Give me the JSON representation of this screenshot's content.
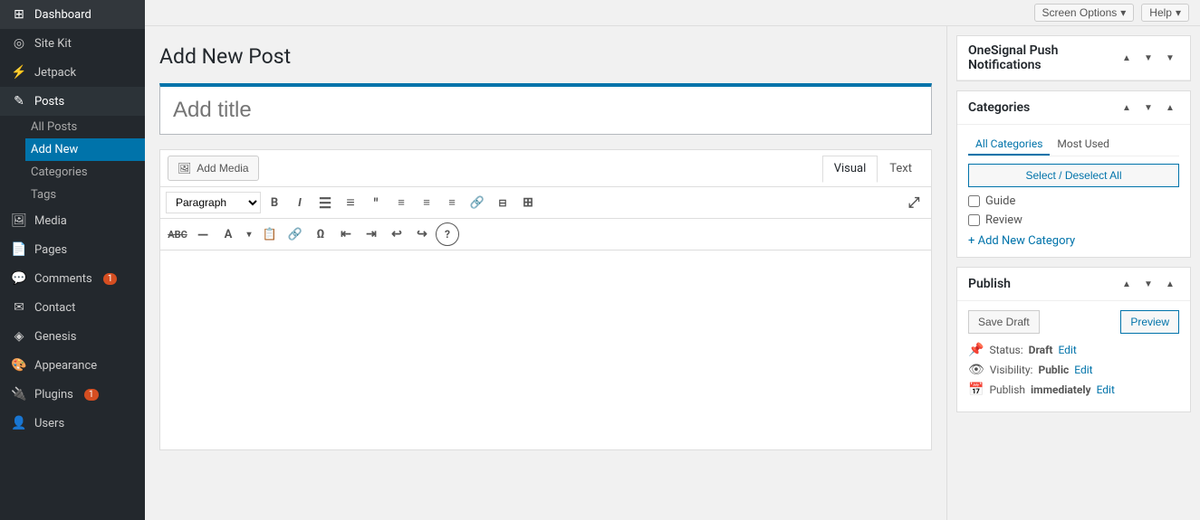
{
  "sidebar": {
    "items": [
      {
        "id": "dashboard",
        "label": "Dashboard",
        "icon": "⊞"
      },
      {
        "id": "site-kit",
        "label": "Site Kit",
        "icon": "◎"
      },
      {
        "id": "jetpack",
        "label": "Jetpack",
        "icon": "⚡"
      },
      {
        "id": "posts",
        "label": "Posts",
        "icon": "✎",
        "active": true,
        "children": [
          {
            "id": "all-posts",
            "label": "All Posts"
          },
          {
            "id": "add-new",
            "label": "Add New",
            "active": true
          },
          {
            "id": "categories",
            "label": "Categories"
          },
          {
            "id": "tags",
            "label": "Tags"
          }
        ]
      },
      {
        "id": "media",
        "label": "Media",
        "icon": "🖼"
      },
      {
        "id": "pages",
        "label": "Pages",
        "icon": "📄"
      },
      {
        "id": "comments",
        "label": "Comments",
        "icon": "💬",
        "badge": "1"
      },
      {
        "id": "contact",
        "label": "Contact",
        "icon": "✉"
      },
      {
        "id": "genesis",
        "label": "Genesis",
        "icon": "◈"
      },
      {
        "id": "appearance",
        "label": "Appearance",
        "icon": "🎨"
      },
      {
        "id": "plugins",
        "label": "Plugins",
        "icon": "🔌",
        "badge": "1"
      },
      {
        "id": "users",
        "label": "Users",
        "icon": "👤"
      }
    ]
  },
  "topbar": {
    "screen_options_label": "Screen Options",
    "help_label": "Help"
  },
  "page": {
    "title": "Add New Post",
    "title_placeholder": "Add title"
  },
  "editor": {
    "add_media_label": "Add Media",
    "view_visual_label": "Visual",
    "view_text_label": "Text",
    "paragraph_label": "Paragraph",
    "toolbar": {
      "bold": "B",
      "italic": "I",
      "ul": "≡",
      "ol": "≡",
      "blockquote": "❝",
      "align_left": "≡",
      "align_center": "≡",
      "align_right": "≡",
      "link": "🔗",
      "unlink": "⊠",
      "table": "⊞",
      "fullscreen": "⤢"
    }
  },
  "sidebar_panel": {
    "onesignal": {
      "title": "OneSignal Push Notifications"
    },
    "categories": {
      "title": "Categories",
      "tab_all": "All Categories",
      "tab_most_used": "Most Used",
      "select_deselect_all": "Select / Deselect All",
      "items": [
        {
          "id": "guide",
          "label": "Guide"
        },
        {
          "id": "review",
          "label": "Review"
        }
      ],
      "add_new_link": "+ Add New Category"
    },
    "publish": {
      "title": "Publish",
      "save_draft_label": "Save Draft",
      "preview_label": "Preview",
      "status_label": "Status:",
      "status_value": "Draft",
      "status_edit": "Edit",
      "visibility_label": "Visibility:",
      "visibility_value": "Public",
      "visibility_edit": "Edit",
      "publish_label": "Publish",
      "publish_value": "immediately",
      "publish_edit": "Edit"
    }
  }
}
